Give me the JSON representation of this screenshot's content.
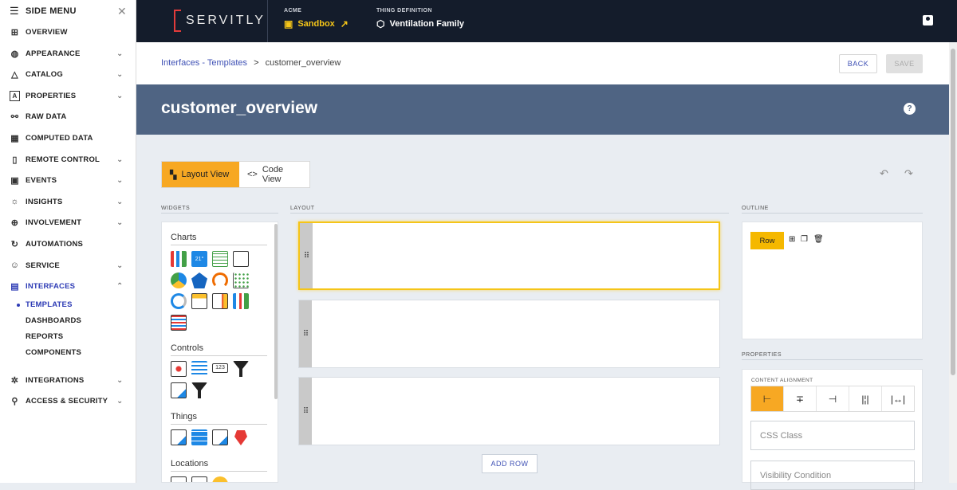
{
  "sidebar": {
    "title": "SIDE MENU",
    "items": [
      {
        "label": "OVERVIEW",
        "icon": "grid-icon",
        "chevron": false
      },
      {
        "label": "APPEARANCE",
        "icon": "palette-icon",
        "chevron": true
      },
      {
        "label": "CATALOG",
        "icon": "shapes-icon",
        "chevron": true
      },
      {
        "label": "PROPERTIES",
        "icon": "property-icon",
        "chevron": true
      },
      {
        "label": "RAW DATA",
        "icon": "nodes-icon",
        "chevron": false
      },
      {
        "label": "COMPUTED DATA",
        "icon": "calculator-icon",
        "chevron": false
      },
      {
        "label": "REMOTE CONTROL",
        "icon": "remote-icon",
        "chevron": true
      },
      {
        "label": "EVENTS",
        "icon": "calendar-icon",
        "chevron": true
      },
      {
        "label": "INSIGHTS",
        "icon": "lightbulb-icon",
        "chevron": true
      },
      {
        "label": "INVOLVEMENT",
        "icon": "plus-circle-icon",
        "chevron": true
      },
      {
        "label": "AUTOMATIONS",
        "icon": "cycle-icon",
        "chevron": false
      },
      {
        "label": "SERVICE",
        "icon": "service-icon",
        "chevron": true
      },
      {
        "label": "INTERFACES",
        "icon": "interfaces-icon",
        "chevron": "up"
      }
    ],
    "subitems": [
      "TEMPLATES",
      "DASHBOARDS",
      "REPORTS",
      "COMPONENTS"
    ],
    "bottom_items": [
      {
        "label": "INTEGRATIONS",
        "icon": "integrations-icon"
      },
      {
        "label": "ACCESS & SECURITY",
        "icon": "lock-icon"
      }
    ]
  },
  "topbar": {
    "logo": "SERVITLY",
    "tenant_label": "ACME",
    "tenant_value": "Sandbox",
    "thing_label": "THING DEFINITION",
    "thing_value": "Ventilation Family"
  },
  "breadcrumb": {
    "parent": "Interfaces - Templates",
    "separator": ">",
    "current": "customer_overview"
  },
  "actions": {
    "back": "BACK",
    "save": "SAVE"
  },
  "page": {
    "title": "customer_overview",
    "help": "?"
  },
  "views": {
    "layout": "Layout View",
    "code": "Code View"
  },
  "sections": {
    "widgets": "WIDGETS",
    "layout": "LAYOUT",
    "outline": "OUTLINE",
    "properties": "PROPERTIES"
  },
  "widget_groups": [
    "Charts",
    "Controls",
    "Things",
    "Locations"
  ],
  "layout": {
    "add_row": "ADD ROW"
  },
  "outline": {
    "row_label": "Row"
  },
  "properties": {
    "content_alignment": "CONTENT ALIGNMENT",
    "css_class_placeholder": "CSS Class",
    "visibility_placeholder": "Visibility Condition"
  },
  "colors": {
    "accent": "#f7a823",
    "topbar": "#141c2b",
    "titlebar": "#4f6483",
    "link": "#3f51b5"
  }
}
